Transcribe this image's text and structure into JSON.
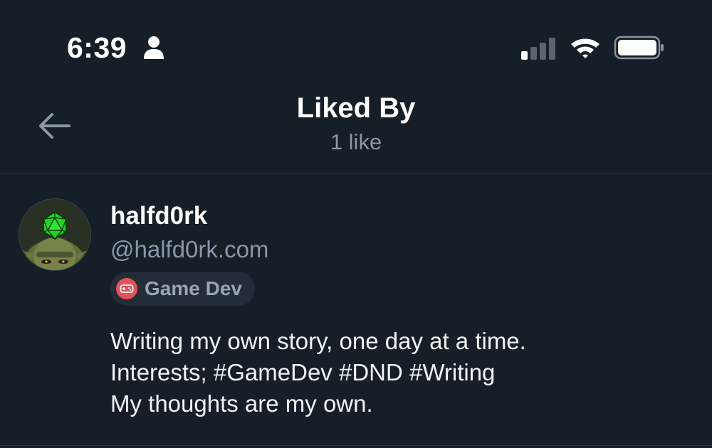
{
  "status_bar": {
    "time": "6:39"
  },
  "header": {
    "title": "Liked By",
    "subtitle": "1 like"
  },
  "likes": [
    {
      "display_name": "halfd0rk",
      "handle": "@halfd0rk.com",
      "tag": {
        "label": "Game Dev",
        "icon": "gamepad-icon",
        "color": "#e2545a"
      },
      "bio_lines": [
        "Writing my own story, one day at a time.",
        "Interests; #GameDev #DND #Writing",
        "My thoughts are my own."
      ]
    }
  ],
  "colors": {
    "background": "#161e27",
    "text_primary": "#ffffff",
    "text_secondary": "#8a97a7",
    "divider": "#2b3542",
    "badge_bg": "#232c38",
    "dice_green": "#2ee62e"
  }
}
